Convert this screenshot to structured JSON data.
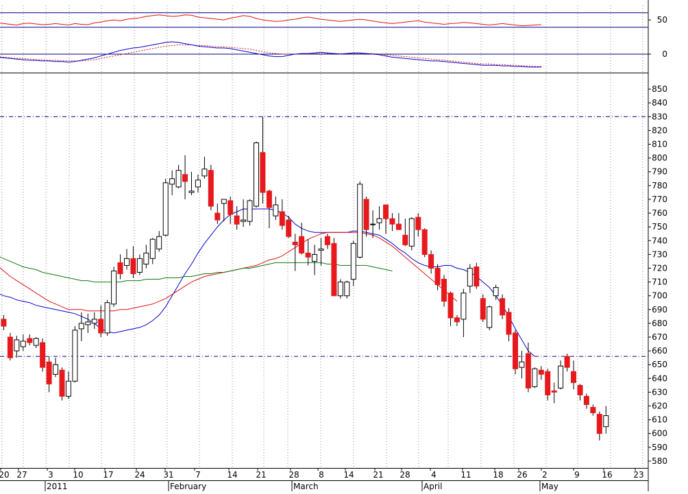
{
  "colors": {
    "background": "#ffffff",
    "bull_fill": "#ffffff",
    "bear_fill": "#e8191c",
    "candle_outline": "#000000",
    "ma_short": "#0000cc",
    "ma_mid": "#dd1111",
    "ma_long": "#117711",
    "grid": "#888888",
    "level": "#000080",
    "rsi": "#dd1111",
    "macd": "#0000cc",
    "macd_signal": "#dd1111"
  },
  "chart_data": [
    {
      "type": "line",
      "panel": "rsi",
      "y_ticks": [
        "50"
      ],
      "ylim": [
        20,
        90
      ],
      "reference_levels": [
        70,
        30
      ],
      "series": [
        {
          "values": [
            42,
            40,
            38,
            36,
            40,
            41,
            39,
            37,
            38,
            40,
            38,
            36,
            40,
            38,
            37,
            42,
            44,
            48,
            50,
            48,
            52,
            54,
            56,
            60,
            62,
            64,
            62,
            60,
            61,
            64,
            63,
            58,
            56,
            54,
            52,
            50,
            55,
            58,
            62,
            60,
            54,
            50,
            48,
            46,
            47,
            50,
            52,
            56,
            58,
            55,
            52,
            50,
            48,
            46,
            48,
            50,
            52,
            50,
            47,
            44,
            42,
            40,
            42,
            44,
            46,
            48,
            44,
            42,
            40,
            38,
            40,
            41,
            43,
            42,
            40,
            38,
            36,
            38,
            40,
            38,
            36,
            34,
            35,
            36,
            37
          ]
        }
      ]
    },
    {
      "type": "line",
      "panel": "macd",
      "y_ticks": [
        "0"
      ],
      "ylim": [
        -30,
        30
      ],
      "series": [
        {
          "values": [
            -5,
            -6,
            -7,
            -8,
            -9,
            -10,
            -10,
            -11,
            -11,
            -12,
            -12,
            -13,
            -12,
            -10,
            -8,
            -6,
            -3,
            0,
            3,
            6,
            8,
            10,
            11,
            13,
            15,
            17,
            19,
            20,
            19,
            17,
            15,
            13,
            12,
            11,
            10,
            10,
            9,
            7,
            5,
            3,
            1,
            -1,
            -3,
            -4,
            -4,
            -2,
            0,
            1,
            1,
            2,
            3,
            2,
            1,
            0,
            1,
            2,
            2,
            1,
            0,
            -1,
            -3,
            -5,
            -6,
            -7,
            -8,
            -9,
            -10,
            -11,
            -11,
            -12,
            -13,
            -14,
            -15,
            -16,
            -17,
            -18,
            -18,
            -18,
            -19,
            -19,
            -20,
            -20,
            -21,
            -21,
            -21
          ]
        },
        {
          "values": [
            -4,
            -5,
            -6,
            -7,
            -7,
            -8,
            -9,
            -9,
            -10,
            -10,
            -11,
            -11,
            -11,
            -11,
            -10,
            -9,
            -7,
            -5,
            -3,
            -1,
            1,
            3,
            5,
            7,
            9,
            11,
            13,
            14,
            15,
            15,
            15,
            14,
            14,
            13,
            12,
            12,
            11,
            10,
            9,
            8,
            6,
            4,
            2,
            1,
            0,
            0,
            0,
            0,
            0,
            1,
            1,
            1,
            1,
            1,
            1,
            1,
            1,
            1,
            1,
            0,
            -1,
            -2,
            -3,
            -4,
            -5,
            -6,
            -7,
            -8,
            -9,
            -10,
            -11,
            -12,
            -13,
            -14,
            -15,
            -16,
            -16,
            -17,
            -17,
            -18,
            -18,
            -19,
            -19,
            -20,
            -20
          ]
        }
      ]
    },
    {
      "type": "candlestick",
      "panel": "price",
      "y_ticks": [
        "850",
        "840",
        "830",
        "820",
        "810",
        "800",
        "790",
        "780",
        "770",
        "760",
        "750",
        "740",
        "730",
        "720",
        "710",
        "700",
        "690",
        "680",
        "670",
        "660",
        "650",
        "640",
        "630",
        "620",
        "610",
        "600",
        "590",
        "580"
      ],
      "ylim": [
        575,
        858
      ],
      "horizontal_levels": [
        830,
        656
      ],
      "x_tick_labels": [
        "20",
        "27",
        "3",
        "10",
        "17",
        "24",
        "31",
        "7",
        "14",
        "21",
        "28",
        "8",
        "14",
        "21",
        "28",
        "4",
        "11",
        "18",
        "26",
        "2",
        "9",
        "16",
        "23"
      ],
      "month_labels": [
        "2011",
        "February",
        "March",
        "April",
        "May"
      ],
      "candles": [
        {
          "o": 690,
          "h": 695,
          "l": 676,
          "c": 680
        },
        {
          "o": 683,
          "h": 686,
          "l": 675,
          "c": 678
        },
        {
          "o": 670,
          "h": 673,
          "l": 653,
          "c": 655
        },
        {
          "o": 660,
          "h": 671,
          "l": 655,
          "c": 668
        },
        {
          "o": 663,
          "h": 672,
          "l": 660,
          "c": 667
        },
        {
          "o": 669,
          "h": 672,
          "l": 664,
          "c": 666
        },
        {
          "o": 664,
          "h": 670,
          "l": 662,
          "c": 669
        },
        {
          "o": 666,
          "h": 669,
          "l": 645,
          "c": 648
        },
        {
          "o": 652,
          "h": 656,
          "l": 630,
          "c": 636
        },
        {
          "o": 643,
          "h": 655,
          "l": 641,
          "c": 650
        },
        {
          "o": 646,
          "h": 648,
          "l": 624,
          "c": 627
        },
        {
          "o": 627,
          "h": 645,
          "l": 625,
          "c": 638
        },
        {
          "o": 638,
          "h": 678,
          "l": 637,
          "c": 675
        },
        {
          "o": 676,
          "h": 688,
          "l": 667,
          "c": 680
        },
        {
          "o": 679,
          "h": 687,
          "l": 673,
          "c": 681
        },
        {
          "o": 680,
          "h": 688,
          "l": 676,
          "c": 683
        },
        {
          "o": 683,
          "h": 693,
          "l": 670,
          "c": 673
        },
        {
          "o": 673,
          "h": 697,
          "l": 671,
          "c": 695
        },
        {
          "o": 694,
          "h": 721,
          "l": 692,
          "c": 718
        },
        {
          "o": 724,
          "h": 730,
          "l": 712,
          "c": 716
        },
        {
          "o": 722,
          "h": 734,
          "l": 719,
          "c": 727
        },
        {
          "o": 727,
          "h": 736,
          "l": 713,
          "c": 716
        },
        {
          "o": 717,
          "h": 730,
          "l": 715,
          "c": 727
        },
        {
          "o": 723,
          "h": 737,
          "l": 720,
          "c": 731
        },
        {
          "o": 727,
          "h": 742,
          "l": 723,
          "c": 741
        },
        {
          "o": 734,
          "h": 747,
          "l": 732,
          "c": 743
        },
        {
          "o": 744,
          "h": 785,
          "l": 743,
          "c": 782
        },
        {
          "o": 781,
          "h": 791,
          "l": 773,
          "c": 785
        },
        {
          "o": 779,
          "h": 795,
          "l": 778,
          "c": 791
        },
        {
          "o": 788,
          "h": 802,
          "l": 770,
          "c": 783
        },
        {
          "o": 775,
          "h": 790,
          "l": 773,
          "c": 776
        },
        {
          "o": 779,
          "h": 788,
          "l": 775,
          "c": 784
        },
        {
          "o": 787,
          "h": 801,
          "l": 785,
          "c": 792
        },
        {
          "o": 791,
          "h": 795,
          "l": 762,
          "c": 765
        },
        {
          "o": 760,
          "h": 767,
          "l": 752,
          "c": 755
        },
        {
          "o": 767,
          "h": 770,
          "l": 754,
          "c": 770
        },
        {
          "o": 769,
          "h": 772,
          "l": 752,
          "c": 759
        },
        {
          "o": 758,
          "h": 765,
          "l": 748,
          "c": 752
        },
        {
          "o": 754,
          "h": 770,
          "l": 750,
          "c": 755
        },
        {
          "o": 754,
          "h": 770,
          "l": 751,
          "c": 769
        },
        {
          "o": 765,
          "h": 812,
          "l": 764,
          "c": 811
        },
        {
          "o": 804,
          "h": 830,
          "l": 767,
          "c": 775
        },
        {
          "o": 776,
          "h": 777,
          "l": 749,
          "c": 764
        },
        {
          "o": 758,
          "h": 772,
          "l": 755,
          "c": 766
        },
        {
          "o": 761,
          "h": 770,
          "l": 748,
          "c": 751
        },
        {
          "o": 755,
          "h": 758,
          "l": 742,
          "c": 743
        },
        {
          "o": 739,
          "h": 745,
          "l": 718,
          "c": 737
        },
        {
          "o": 743,
          "h": 753,
          "l": 730,
          "c": 731
        },
        {
          "o": 731,
          "h": 741,
          "l": 722,
          "c": 728
        },
        {
          "o": 725,
          "h": 737,
          "l": 715,
          "c": 730
        },
        {
          "o": 733,
          "h": 742,
          "l": 722,
          "c": 734
        },
        {
          "o": 743,
          "h": 745,
          "l": 734,
          "c": 737
        },
        {
          "o": 738,
          "h": 742,
          "l": 717,
          "c": 700
        },
        {
          "o": 700,
          "h": 712,
          "l": 698,
          "c": 710
        },
        {
          "o": 700,
          "h": 711,
          "l": 698,
          "c": 710
        },
        {
          "o": 712,
          "h": 740,
          "l": 707,
          "c": 738
        },
        {
          "o": 728,
          "h": 783,
          "l": 727,
          "c": 781
        },
        {
          "o": 770,
          "h": 772,
          "l": 743,
          "c": 748
        },
        {
          "o": 752,
          "h": 762,
          "l": 742,
          "c": 752
        },
        {
          "o": 753,
          "h": 765,
          "l": 748,
          "c": 756
        },
        {
          "o": 766,
          "h": 766,
          "l": 745,
          "c": 756
        },
        {
          "o": 756,
          "h": 760,
          "l": 747,
          "c": 752
        },
        {
          "o": 752,
          "h": 760,
          "l": 748,
          "c": 748
        },
        {
          "o": 744,
          "h": 756,
          "l": 736,
          "c": 737
        },
        {
          "o": 736,
          "h": 757,
          "l": 733,
          "c": 756
        },
        {
          "o": 757,
          "h": 760,
          "l": 743,
          "c": 748
        },
        {
          "o": 748,
          "h": 749,
          "l": 728,
          "c": 730
        },
        {
          "o": 730,
          "h": 733,
          "l": 716,
          "c": 720
        },
        {
          "o": 720,
          "h": 723,
          "l": 704,
          "c": 708
        },
        {
          "o": 712,
          "h": 715,
          "l": 692,
          "c": 696
        },
        {
          "o": 702,
          "h": 703,
          "l": 678,
          "c": 684
        },
        {
          "o": 684,
          "h": 686,
          "l": 678,
          "c": 681
        },
        {
          "o": 683,
          "h": 705,
          "l": 670,
          "c": 702
        },
        {
          "o": 707,
          "h": 723,
          "l": 702,
          "c": 720
        },
        {
          "o": 721,
          "h": 724,
          "l": 705,
          "c": 707
        },
        {
          "o": 698,
          "h": 701,
          "l": 681,
          "c": 683
        },
        {
          "o": 677,
          "h": 693,
          "l": 675,
          "c": 692
        },
        {
          "o": 700,
          "h": 708,
          "l": 697,
          "c": 706
        },
        {
          "o": 698,
          "h": 701,
          "l": 683,
          "c": 686
        },
        {
          "o": 688,
          "h": 691,
          "l": 667,
          "c": 672
        },
        {
          "o": 673,
          "h": 675,
          "l": 643,
          "c": 647
        },
        {
          "o": 648,
          "h": 660,
          "l": 640,
          "c": 652
        },
        {
          "o": 658,
          "h": 666,
          "l": 630,
          "c": 633
        },
        {
          "o": 634,
          "h": 648,
          "l": 633,
          "c": 647
        },
        {
          "o": 646,
          "h": 649,
          "l": 639,
          "c": 643
        },
        {
          "o": 645,
          "h": 647,
          "l": 624,
          "c": 628
        },
        {
          "o": 631,
          "h": 637,
          "l": 622,
          "c": 630
        },
        {
          "o": 633,
          "h": 653,
          "l": 632,
          "c": 649
        },
        {
          "o": 656,
          "h": 658,
          "l": 645,
          "c": 648
        },
        {
          "o": 645,
          "h": 653,
          "l": 632,
          "c": 637
        },
        {
          "o": 635,
          "h": 636,
          "l": 624,
          "c": 628
        },
        {
          "o": 627,
          "h": 629,
          "l": 618,
          "c": 621
        },
        {
          "o": 619,
          "h": 621,
          "l": 613,
          "c": 615
        },
        {
          "o": 614,
          "h": 616,
          "l": 595,
          "c": 600
        },
        {
          "o": 605,
          "h": 620,
          "l": 600,
          "c": 613
        }
      ],
      "series": [
        {
          "name_shown": false,
          "values": [
            702,
            700,
            699,
            697,
            696,
            695,
            693,
            692,
            691,
            690,
            689,
            688,
            687,
            685,
            683,
            680,
            676,
            674,
            673,
            674,
            675,
            676,
            677,
            679,
            682,
            686,
            692,
            700,
            708,
            716,
            723,
            731,
            738,
            744,
            750,
            755,
            759,
            761,
            763,
            763,
            763,
            763,
            763,
            762,
            760,
            757,
            752,
            749,
            747,
            746,
            746,
            746,
            746,
            746,
            746,
            747,
            747,
            746,
            745,
            744,
            741,
            738,
            734,
            731,
            727,
            724,
            722,
            721,
            721,
            722,
            722,
            720,
            719,
            717,
            714,
            710,
            706,
            700,
            693,
            685,
            676,
            668,
            660,
            656
          ]
        },
        {
          "name_shown": false,
          "values": [
            722,
            718,
            714,
            711,
            708,
            705,
            702,
            699,
            696,
            694,
            692,
            690,
            690,
            690,
            689,
            689,
            689,
            689,
            689,
            690,
            690,
            691,
            692,
            693,
            694,
            696,
            698,
            701,
            704,
            707,
            710,
            712,
            714,
            715,
            716,
            717,
            718,
            719,
            720,
            721,
            722,
            724,
            726,
            727,
            729,
            732,
            735,
            738,
            741,
            743,
            745,
            746,
            746,
            746,
            746,
            746,
            746,
            745,
            744,
            742,
            739,
            736,
            732,
            728,
            724,
            720,
            716,
            712,
            708,
            704,
            700,
            696
          ]
        },
        {
          "name_shown": false,
          "values": [
            729,
            727,
            725,
            723,
            721,
            720,
            719,
            717,
            716,
            715,
            714,
            713,
            712,
            711,
            711,
            710,
            710,
            710,
            710,
            710,
            711,
            711,
            711,
            712,
            712,
            712,
            713,
            713,
            713,
            714,
            714,
            715,
            716,
            716,
            717,
            717,
            718,
            719,
            720,
            720,
            721,
            722,
            723,
            724,
            724,
            724,
            724,
            724,
            724,
            724,
            724,
            723,
            723,
            722,
            722,
            722,
            722,
            722,
            721,
            720,
            719,
            718
          ]
        }
      ]
    }
  ]
}
